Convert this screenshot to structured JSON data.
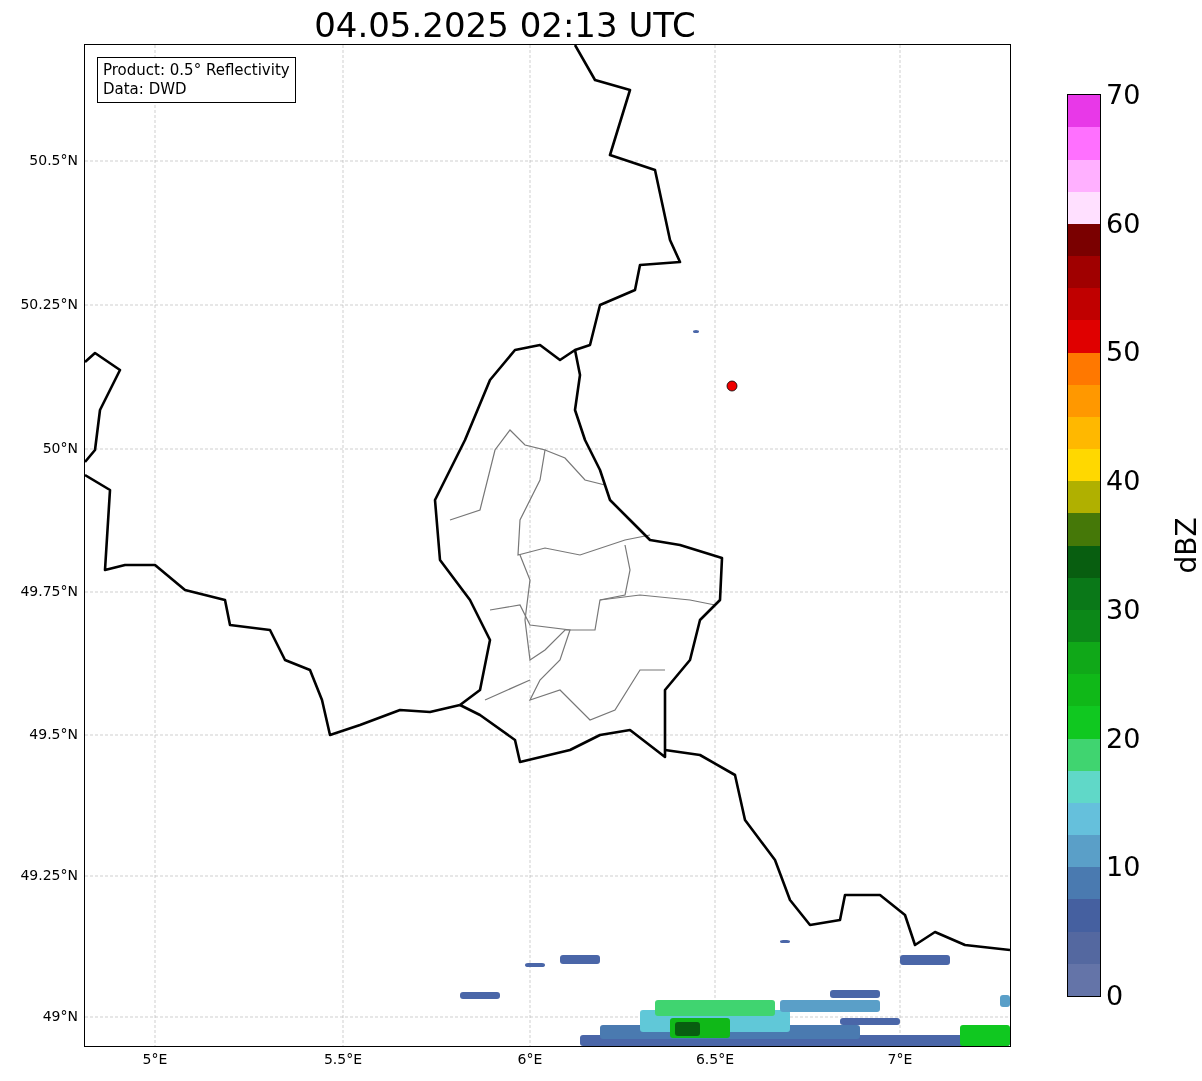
{
  "title": "04.05.2025 02:13 UTC",
  "info_box": {
    "lines": [
      "Product: 0.5° Reflectivity",
      "Data: DWD"
    ]
  },
  "map": {
    "lat_ticks": [
      "50.5°N",
      "50.25°N",
      "50°N",
      "49.75°N",
      "49.5°N",
      "49.25°N",
      "49°N"
    ],
    "lon_ticks": [
      "5°E",
      "5.5°E",
      "6°E",
      "6.5°E",
      "7°E"
    ]
  },
  "colorbar": {
    "label": "dBZ",
    "ticks": [
      "70",
      "60",
      "50",
      "40",
      "30",
      "20",
      "10",
      "0"
    ],
    "segments": [
      {
        "color": "#6474a8"
      },
      {
        "color": "#5468a0"
      },
      {
        "color": "#4560a0"
      },
      {
        "color": "#4a7ab0"
      },
      {
        "color": "#5a9fc8"
      },
      {
        "color": "#65c0dc"
      },
      {
        "color": "#60d8c8"
      },
      {
        "color": "#40d470"
      },
      {
        "color": "#10c820"
      },
      {
        "color": "#10b818"
      },
      {
        "color": "#10a818"
      },
      {
        "color": "#0c8818"
      },
      {
        "color": "#0a7818"
      },
      {
        "color": "#085e10"
      },
      {
        "color": "#457808"
      },
      {
        "color": "#b0b000"
      },
      {
        "color": "#ffd800"
      },
      {
        "color": "#ffb800"
      },
      {
        "color": "#ff9800"
      },
      {
        "color": "#ff7800"
      },
      {
        "color": "#e00000"
      },
      {
        "color": "#c00000"
      },
      {
        "color": "#a00000"
      },
      {
        "color": "#7a0000"
      },
      {
        "color": "#ffe0ff"
      },
      {
        "color": "#ffb0ff"
      },
      {
        "color": "#ff70ff"
      },
      {
        "color": "#e838e8"
      }
    ]
  }
}
